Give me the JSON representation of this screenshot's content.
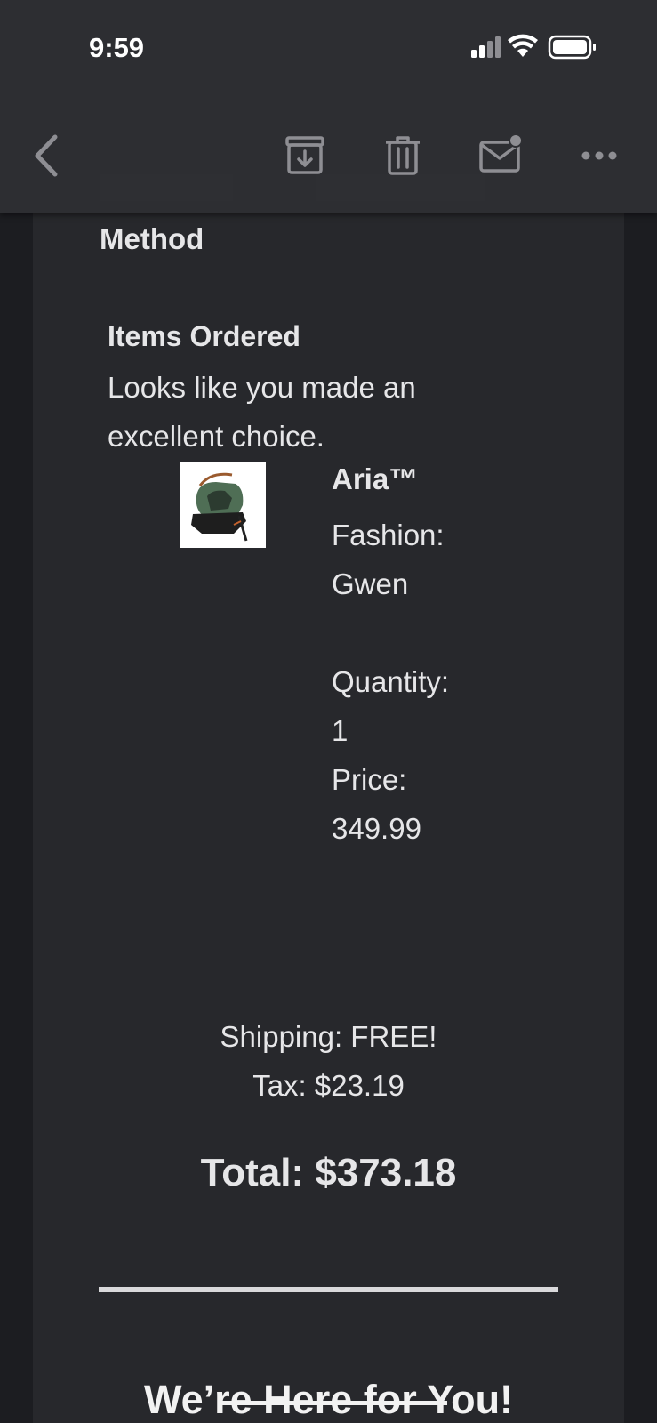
{
  "status_bar": {
    "time": "9:59"
  },
  "toolbar": {
    "back_icon": "chevron-left-icon",
    "archive_icon": "archive-icon",
    "delete_icon": "trash-icon",
    "mark_unread_icon": "mail-unread-icon",
    "more_icon": "more-horizontal-icon"
  },
  "payment": {
    "label": "Method"
  },
  "items": {
    "heading": "Items Ordered",
    "subtitle_line1": "Looks like you made an",
    "subtitle_line2": "excellent choice.",
    "product": {
      "name": "Aria™",
      "fashion_label": "Fashion:",
      "fashion_value": "Gwen",
      "quantity_label": "Quantity:",
      "quantity_value": "1",
      "price_label": "Price:",
      "price_value": "349.99"
    }
  },
  "summary": {
    "shipping": "Shipping: FREE!",
    "tax": "Tax: $23.19",
    "total": "Total: $373.18"
  },
  "footer": {
    "heading": "We’re Here for You!"
  },
  "colors": {
    "background": "#1c1d21",
    "card": "#27282c",
    "toolbar": "#2e2f33",
    "text": "#e6e6e8"
  }
}
